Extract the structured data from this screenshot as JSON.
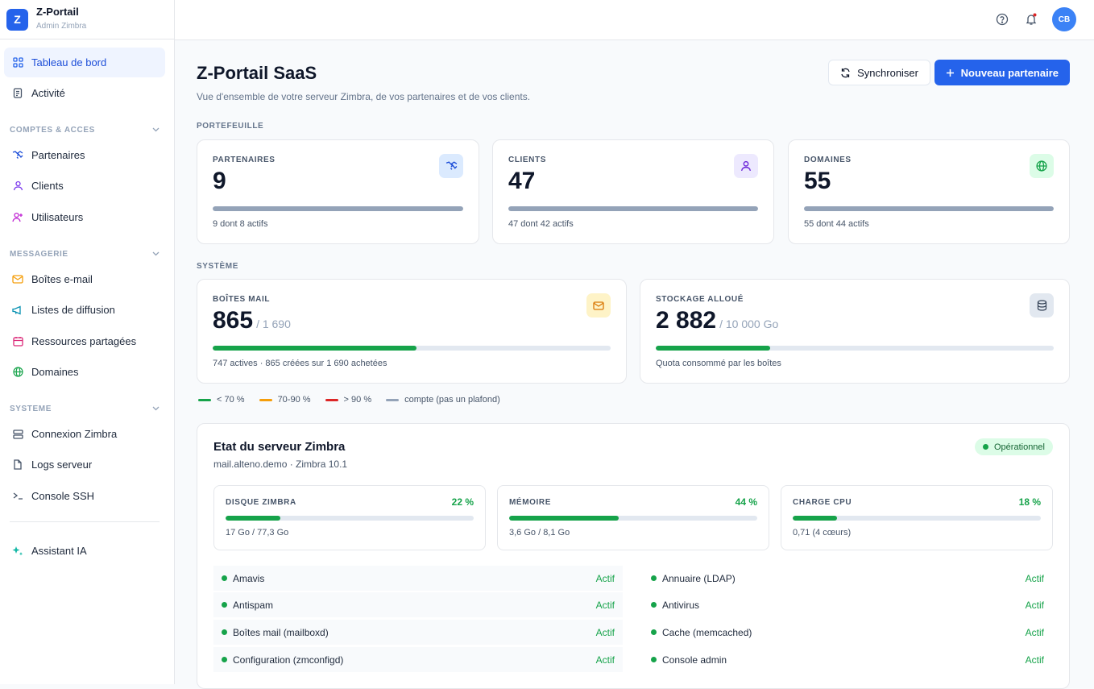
{
  "brand": {
    "logo": "Z",
    "title": "Z-Portail",
    "subtitle": "Admin Zimbra"
  },
  "nav": {
    "dashboard": "Tableau de bord",
    "activity": "Activité",
    "section_accounts": "COMPTES & ACCES",
    "partners": "Partenaires",
    "clients": "Clients",
    "users": "Utilisateurs",
    "section_mail": "MESSAGERIE",
    "mailboxes": "Boîtes e-mail",
    "lists": "Listes de diffusion",
    "resources": "Ressources partagées",
    "domains": "Domaines",
    "section_system": "SYSTEME",
    "zimbra_conn": "Connexion Zimbra",
    "logs": "Logs serveur",
    "ssh": "Console SSH",
    "assistant": "Assistant IA"
  },
  "topbar": {
    "avatar": "CB"
  },
  "header": {
    "title": "Z-Portail SaaS",
    "subtitle": "Vue d'ensemble de votre serveur Zimbra, de vos partenaires et de vos clients.",
    "sync_label": "Synchroniser",
    "new_label": "Nouveau partenaire"
  },
  "portfolio": {
    "label": "PORTEFEUILLE",
    "partners": {
      "label": "PARTENAIRES",
      "value": "9",
      "foot": "9 dont 8 actifs"
    },
    "clients": {
      "label": "CLIENTS",
      "value": "47",
      "foot": "47 dont 42 actifs"
    },
    "domains": {
      "label": "DOMAINES",
      "value": "55",
      "foot": "55 dont 44 actifs"
    }
  },
  "system": {
    "label": "SYSTÈME",
    "mailboxes": {
      "label": "BOÎTES MAIL",
      "value": "865",
      "total": "/ 1 690",
      "foot": "747 actives · 865 créées sur 1 690 achetées",
      "fill": 0.512
    },
    "storage": {
      "label": "STOCKAGE ALLOUÉ",
      "value": "2 882",
      "total": "/ 10 000 Go",
      "foot": "Quota consommé par les boîtes",
      "fill": 0.288
    }
  },
  "legend": {
    "green": "< 70 %",
    "orange": "70-90 %",
    "red": "> 90 %",
    "gray": "compte (pas un plafond)"
  },
  "colors": {
    "green": "#16a34a",
    "orange": "#f59e0b",
    "red": "#dc2626",
    "gray": "#94a3b8",
    "accent": "#2563eb"
  },
  "server": {
    "title": "Etat du serveur Zimbra",
    "subtitle": "mail.alteno.demo · Zimbra 10.1",
    "status": "Opérationnel",
    "disk": {
      "label": "DISQUE ZIMBRA",
      "pct": "22 %",
      "foot": "17 Go / 77,3 Go",
      "fill": 0.22
    },
    "memory": {
      "label": "MÉMOIRE",
      "pct": "44 %",
      "foot": "3,6 Go / 8,1 Go",
      "fill": 0.44
    },
    "cpu": {
      "label": "CHARGE CPU",
      "pct": "18 %",
      "foot": "0,71 (4 cœurs)",
      "fill": 0.18
    },
    "services": [
      {
        "name": "Amavis",
        "status": "Actif"
      },
      {
        "name": "Annuaire (LDAP)",
        "status": "Actif"
      },
      {
        "name": "Antispam",
        "status": "Actif"
      },
      {
        "name": "Antivirus",
        "status": "Actif"
      },
      {
        "name": "Boîtes mail (mailboxd)",
        "status": "Actif"
      },
      {
        "name": "Cache (memcached)",
        "status": "Actif"
      },
      {
        "name": "Configuration (zmconfigd)",
        "status": "Actif"
      },
      {
        "name": "Console admin",
        "status": "Actif"
      }
    ]
  }
}
